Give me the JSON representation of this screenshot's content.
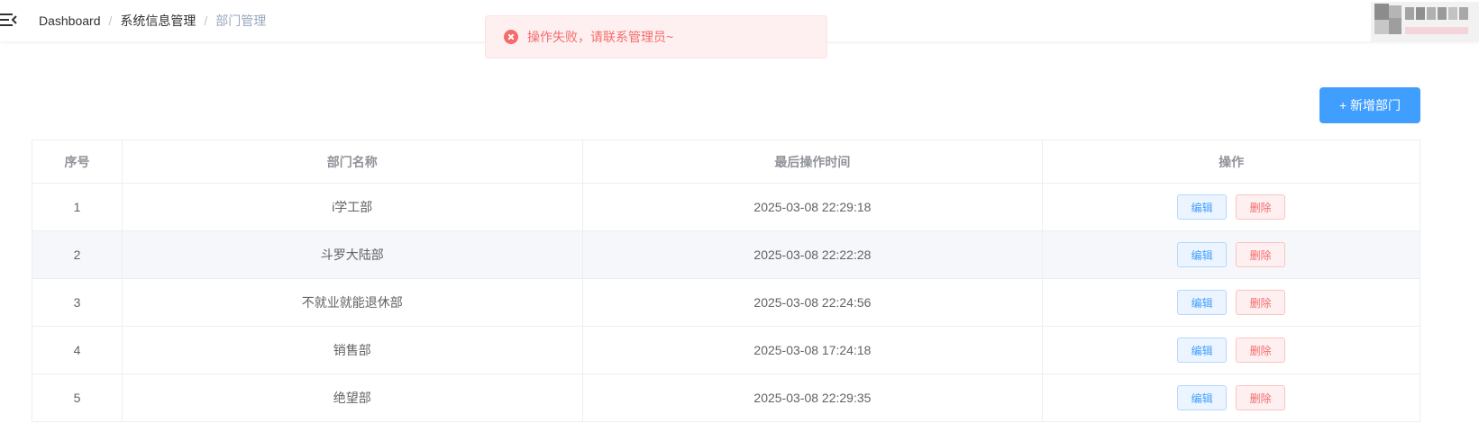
{
  "header": {
    "breadcrumb": [
      "Dashboard",
      "系统信息管理",
      "部门管理"
    ],
    "separator": "/"
  },
  "message": {
    "type": "error",
    "text": "操作失败，请联系管理员~"
  },
  "toolbar": {
    "add_label": "+ 新增部门"
  },
  "table": {
    "columns": [
      "序号",
      "部门名称",
      "最后操作时间",
      "操作"
    ],
    "rows": [
      {
        "index": "1",
        "name": "i学工部",
        "time": "2025-03-08 22:29:18"
      },
      {
        "index": "2",
        "name": "斗罗大陆部",
        "time": "2025-03-08 22:22:28"
      },
      {
        "index": "3",
        "name": "不就业就能退休部",
        "time": "2025-03-08 22:24:56"
      },
      {
        "index": "4",
        "name": "销售部",
        "time": "2025-03-08 17:24:18"
      },
      {
        "index": "5",
        "name": "绝望部",
        "time": "2025-03-08 22:29:35"
      }
    ],
    "edit_label": "编辑",
    "delete_label": "删除"
  },
  "colors": {
    "primary": "#409eff",
    "danger": "#f56c6c"
  }
}
